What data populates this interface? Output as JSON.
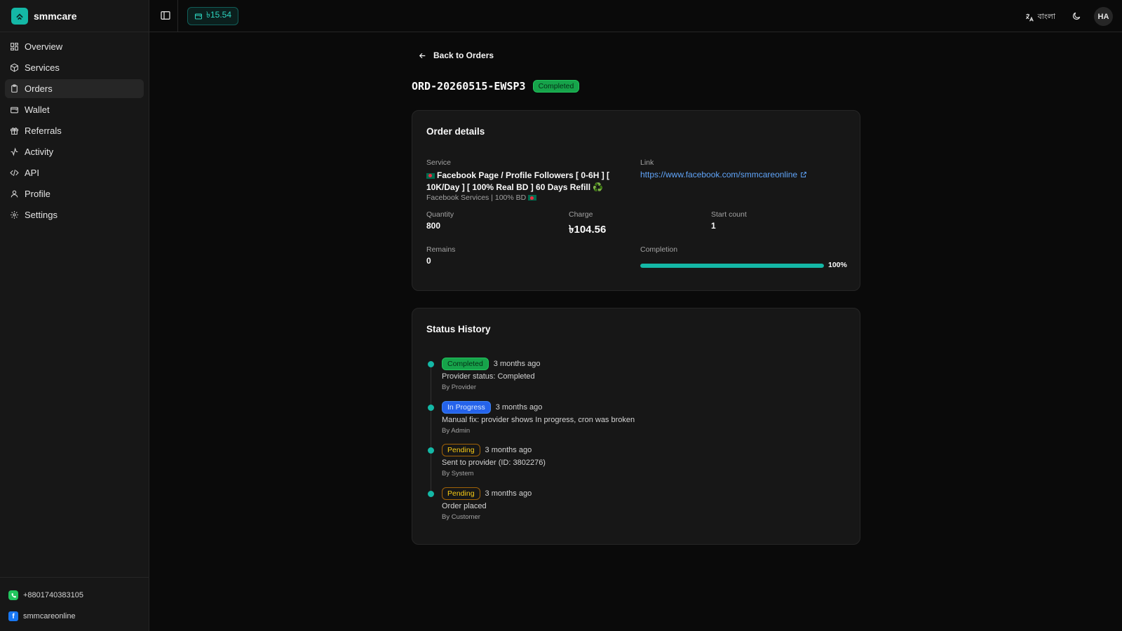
{
  "brand": {
    "name": "smmcare"
  },
  "sidebar": {
    "items": [
      {
        "label": "Overview",
        "icon": "grid-icon"
      },
      {
        "label": "Services",
        "icon": "package-icon"
      },
      {
        "label": "Orders",
        "icon": "clipboard-icon",
        "active": true
      },
      {
        "label": "Wallet",
        "icon": "wallet-icon"
      },
      {
        "label": "Referrals",
        "icon": "gift-icon"
      },
      {
        "label": "Activity",
        "icon": "activity-icon"
      },
      {
        "label": "API",
        "icon": "code-icon"
      },
      {
        "label": "Profile",
        "icon": "user-icon"
      },
      {
        "label": "Settings",
        "icon": "settings-icon"
      }
    ],
    "footer": {
      "whatsapp": "+8801740383105",
      "facebook": "smmcareonline"
    }
  },
  "topbar": {
    "balance": "৳15.54",
    "language": "বাংলা",
    "avatar": "HA"
  },
  "page": {
    "back_label": "Back to Orders",
    "order_id": "ORD-20260515-EWSP3",
    "status": "Completed"
  },
  "details": {
    "title": "Order details",
    "service_label": "Service",
    "service_name": "Facebook Page / Profile Followers [ 0-6H ] [ 10K/Day ] [ 100% Real BD ] 60 Days Refill ♻️",
    "service_category": "Facebook Services | 100% BD",
    "link_label": "Link",
    "link": "https://www.facebook.com/smmcareonline",
    "quantity_label": "Quantity",
    "quantity": "800",
    "charge_label": "Charge",
    "charge": "৳104.56",
    "start_count_label": "Start count",
    "start_count": "1",
    "remains_label": "Remains",
    "remains": "0",
    "completion_label": "Completion",
    "completion_percent": 100,
    "completion_text": "100%"
  },
  "history": {
    "title": "Status History",
    "entries": [
      {
        "status": "Completed",
        "status_type": "completed",
        "time": "3 months ago",
        "message": "Provider status: Completed",
        "by": "By Provider"
      },
      {
        "status": "In Progress",
        "status_type": "progress",
        "time": "3 months ago",
        "message": "Manual fix: provider shows In progress, cron was broken",
        "by": "By Admin"
      },
      {
        "status": "Pending",
        "status_type": "pending",
        "time": "3 months ago",
        "message": "Sent to provider (ID: 3802276)",
        "by": "By System"
      },
      {
        "status": "Pending",
        "status_type": "pending",
        "time": "3 months ago",
        "message": "Order placed",
        "by": "By Customer"
      }
    ]
  },
  "colors": {
    "accent": "#14b8a6",
    "completed": "#16a34a",
    "progress": "#2563eb",
    "pending": "#facc15",
    "link": "#60a5fa"
  }
}
